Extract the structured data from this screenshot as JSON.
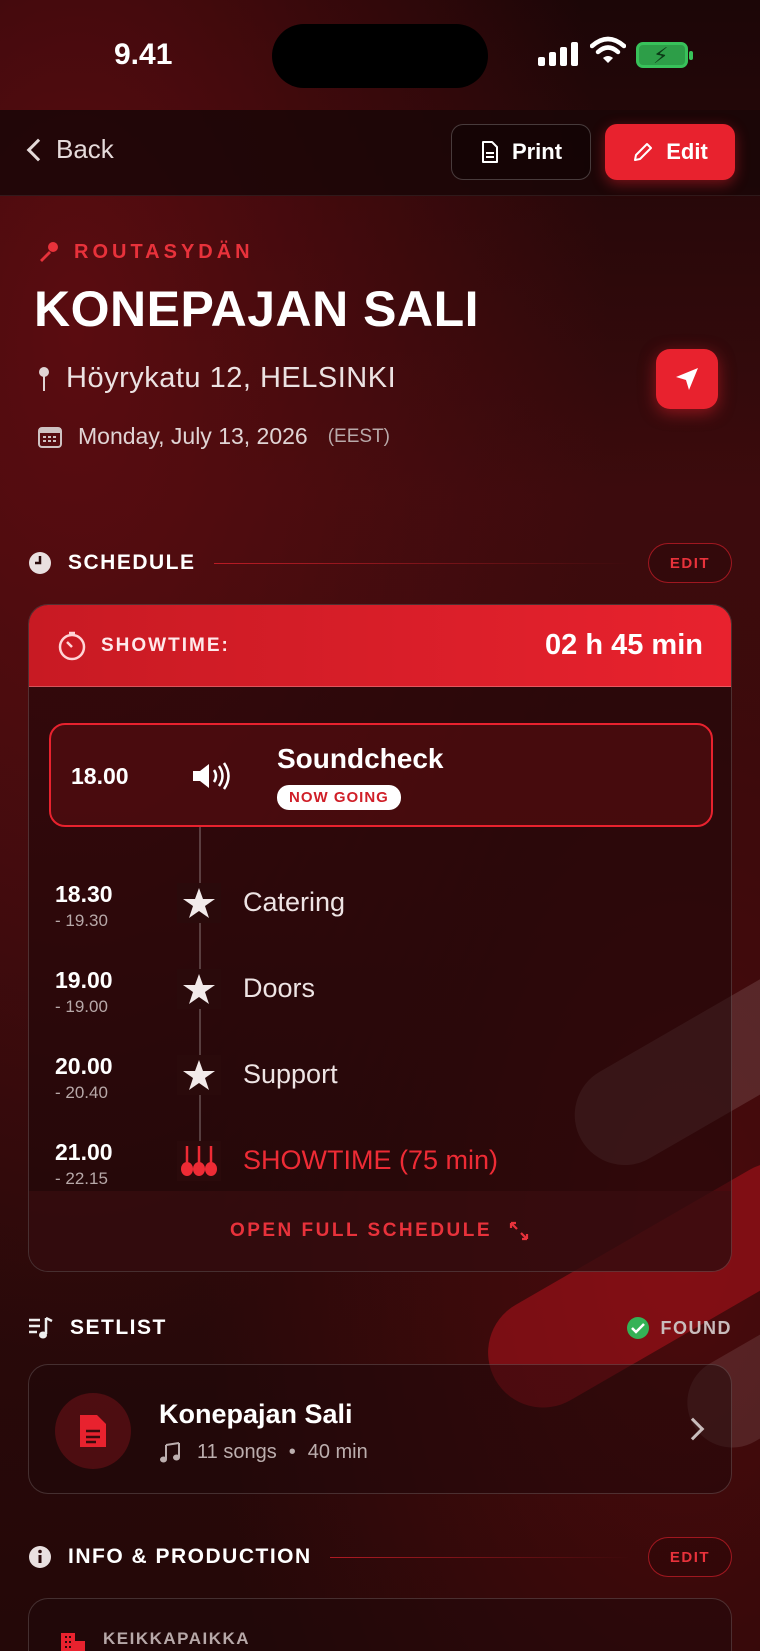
{
  "status_bar": {
    "time": "9.41"
  },
  "nav": {
    "back_label": "Back",
    "print_label": "Print",
    "edit_label": "Edit"
  },
  "header": {
    "artist": "ROUTASYDÄN",
    "venue": "KONEPAJAN SALI",
    "address": "Höyrykatu 12, HELSINKI",
    "date": "Monday, July 13, 2026",
    "timezone": "(EEST)"
  },
  "schedule": {
    "title": "SCHEDULE",
    "edit_label": "EDIT",
    "showtime_label": "SHOWTIME:",
    "showtime_countdown": "02 h 45 min",
    "current": {
      "time": "18.00",
      "name": "Soundcheck",
      "badge": "NOW GOING",
      "icon": "speaker-icon"
    },
    "items": [
      {
        "start": "18.30",
        "end": "- 19.30",
        "name": "Catering",
        "icon": "star-icon"
      },
      {
        "start": "19.00",
        "end": "- 19.00",
        "name": "Doors",
        "icon": "star-icon"
      },
      {
        "start": "20.00",
        "end": "- 20.40",
        "name": "Support",
        "icon": "star-icon"
      },
      {
        "start": "21.00",
        "end": "- 22.15",
        "name": "SHOWTIME (75 min)",
        "icon": "guitars-icon"
      }
    ],
    "open_full_label": "OPEN FULL SCHEDULE"
  },
  "setlist": {
    "title": "SETLIST",
    "status": "FOUND",
    "name": "Konepajan Sali",
    "songs": "11 songs",
    "separator": "•",
    "duration": "40 min"
  },
  "info": {
    "title": "INFO & PRODUCTION",
    "edit_label": "EDIT",
    "first_label": "KEIKKAPAIKKA"
  },
  "colors": {
    "accent": "#e8222e",
    "background": "#2a0a0b",
    "success": "#34b256"
  }
}
